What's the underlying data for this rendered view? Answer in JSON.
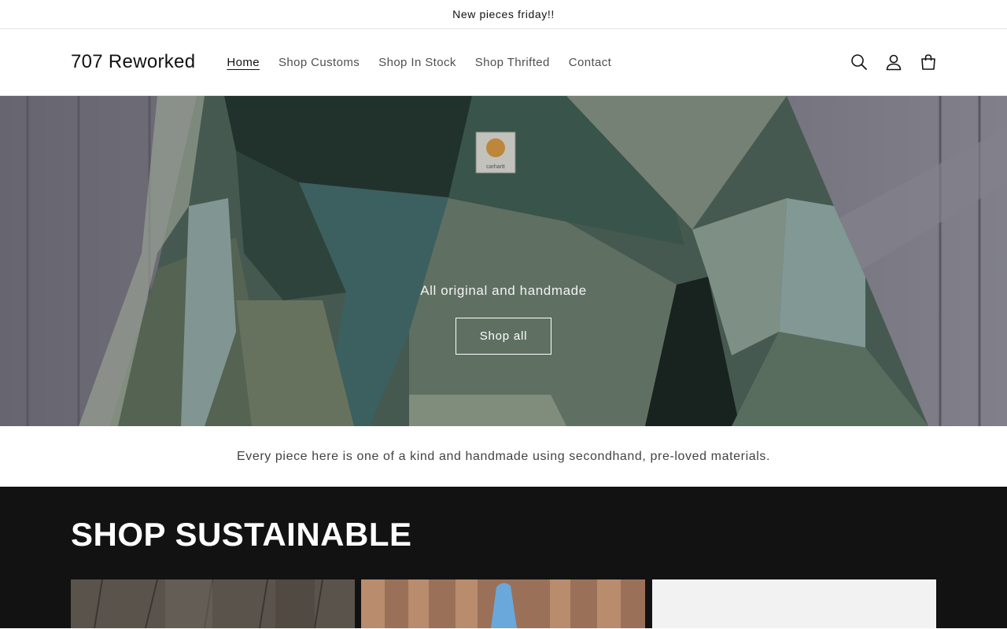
{
  "announcement": {
    "text": "New pieces friday!!"
  },
  "header": {
    "logo": "707 Reworked",
    "nav": [
      {
        "label": "Home",
        "active": true
      },
      {
        "label": "Shop Customs"
      },
      {
        "label": "Shop In Stock"
      },
      {
        "label": "Shop Thrifted"
      },
      {
        "label": "Contact"
      }
    ],
    "icons": [
      "search-icon",
      "account-icon",
      "cart-icon"
    ]
  },
  "hero": {
    "text": "All original and handmade",
    "button_label": "Shop all",
    "patch_label": "carhartt"
  },
  "tagline": {
    "text": "Every piece here is one of a kind and handmade using secondhand, pre-loved materials."
  },
  "collection": {
    "title": "SHOP SUSTAINABLE"
  },
  "colors": {
    "collection_bg": "#121212",
    "hero_wall": "#777580",
    "fabric_dark": "#2b3a34",
    "fabric_teal": "#4c6e6a",
    "fabric_sage": "#6f7f6a"
  }
}
